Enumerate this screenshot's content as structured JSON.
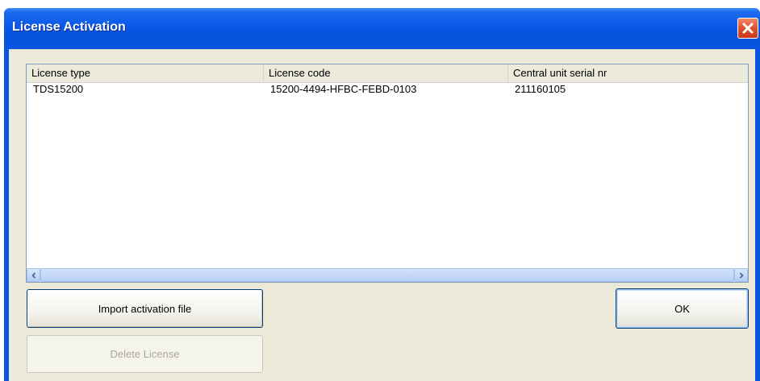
{
  "window": {
    "title": "License Activation",
    "close_icon": "close-icon"
  },
  "list": {
    "columns": [
      "License type",
      "License code",
      "Central unit serial nr"
    ],
    "rows": [
      [
        "TDS15200",
        "15200-4494-HFBC-FEBD-0103",
        "211160105"
      ]
    ]
  },
  "buttons": {
    "import_label": "Import activation file",
    "delete_label": "Delete License",
    "ok_label": "OK"
  },
  "colors": {
    "titlebar": "#0a55e0",
    "close": "#e0502c",
    "face": "#ece9d8"
  }
}
